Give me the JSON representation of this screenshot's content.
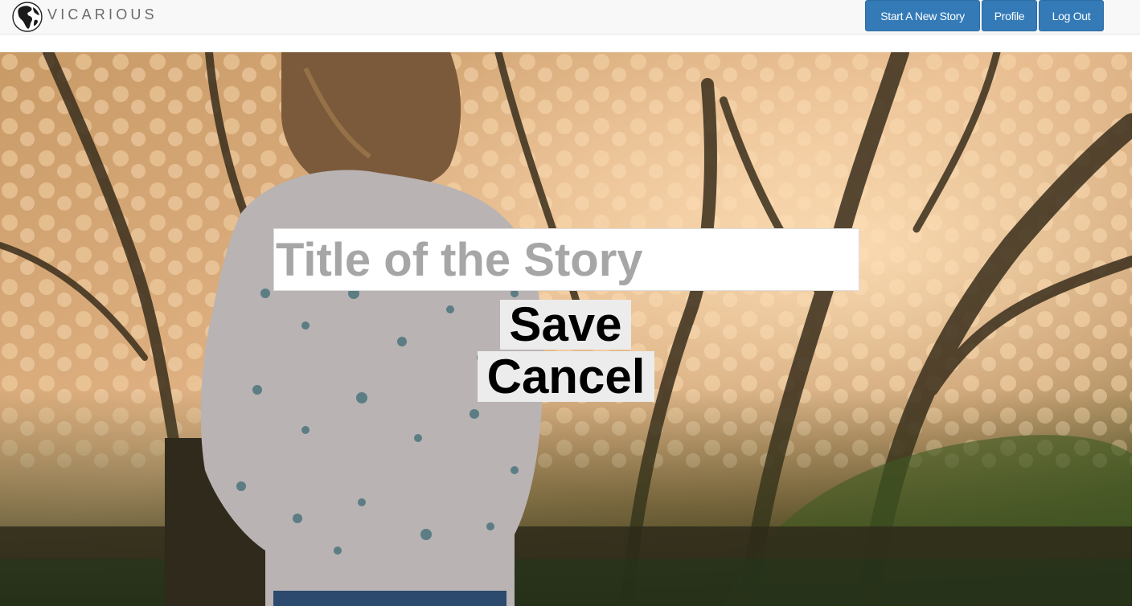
{
  "navbar": {
    "brand_icon": "globe-icon",
    "brand_text": "VICARIOUS",
    "buttons": {
      "new_story": "Start A New Story",
      "profile": "Profile",
      "logout": "Log Out"
    },
    "button_color": "#337ab7"
  },
  "editor": {
    "title_input": {
      "value": "",
      "placeholder": "Title of the Story"
    },
    "save_label": "Save",
    "cancel_label": "Cancel"
  },
  "hero": {
    "background": "photo-woman-by-fence-at-sunset"
  }
}
